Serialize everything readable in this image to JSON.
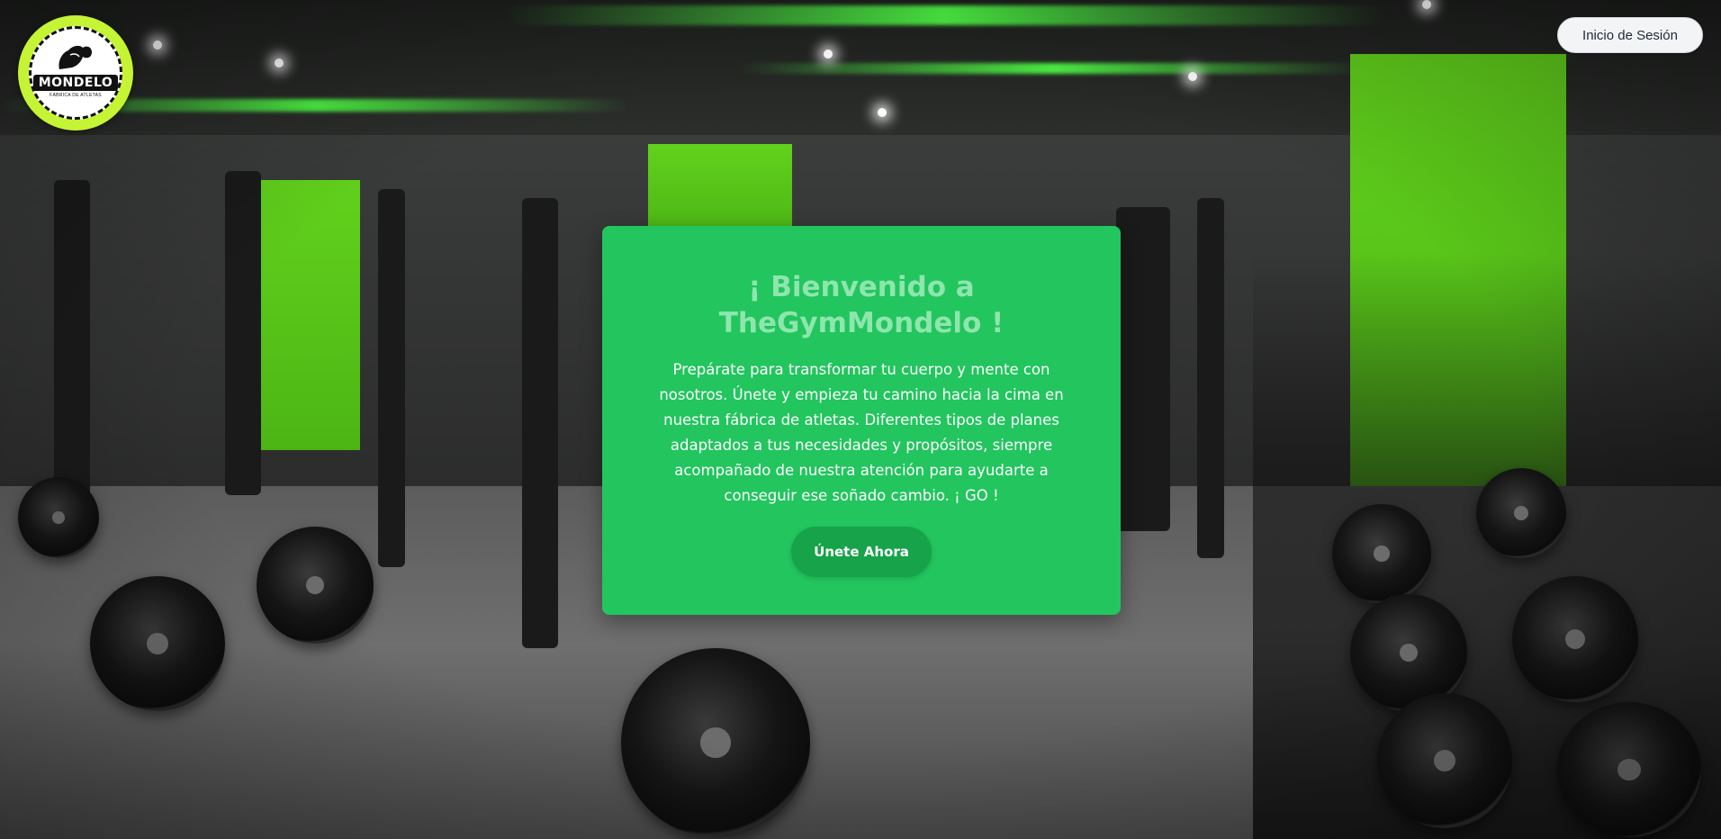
{
  "header": {
    "logo": {
      "brand_text": "MONDELO",
      "tagline": "FÁBRICA DE ATLETAS",
      "icon": "flexed-arm-icon"
    },
    "login_label": "Inicio de Sesión"
  },
  "hero": {
    "title": "¡ Bienvenido a TheGymMondelo !",
    "description": "Prepárate para transformar tu cuerpo y mente con nosotros. Únete y empieza tu camino hacia la cima en nuestra fábrica de atletas. Diferentes tipos de planes adaptados a tus necesidades y propósitos, siempre acompañado de nuestra atención para ayudarte a conseguir ese soñado cambio. ¡ GO !",
    "cta_label": "Únete Ahora"
  },
  "colors": {
    "card_background": "#22c55e",
    "title_color": "#8ee6ad",
    "cta_background": "#16a34a",
    "logo_ring": "#c4f433",
    "login_background": "#f3f4f6"
  }
}
